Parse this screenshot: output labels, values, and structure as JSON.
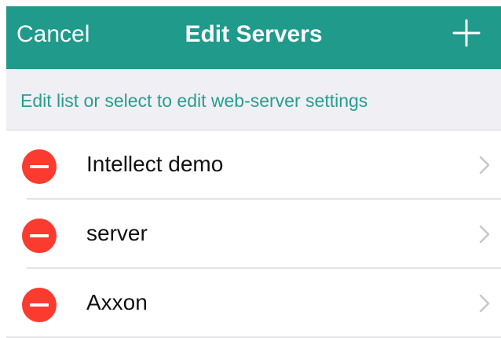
{
  "navbar": {
    "cancel_label": "Cancel",
    "title": "Edit Servers",
    "add_icon": "plus-icon",
    "background_color": "#1f9a8b",
    "text_color": "#ffffff"
  },
  "hint": {
    "text": "Edit list or select to edit web-server settings",
    "color": "#2a9d8f"
  },
  "servers": [
    {
      "name": "Intellect demo",
      "delete_icon": "minus-circle-icon",
      "disclosure_icon": "chevron-right-icon"
    },
    {
      "name": "server",
      "delete_icon": "minus-circle-icon",
      "disclosure_icon": "chevron-right-icon"
    },
    {
      "name": "Axxon",
      "delete_icon": "minus-circle-icon",
      "disclosure_icon": "chevron-right-icon"
    }
  ],
  "colors": {
    "delete_red": "#fb3b30",
    "chevron_gray": "#c7c7cc",
    "hint_background": "#efeff4"
  }
}
